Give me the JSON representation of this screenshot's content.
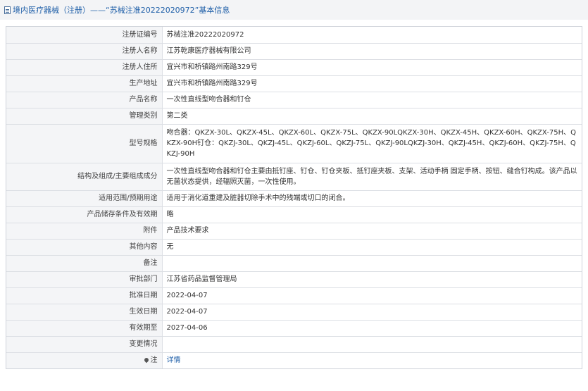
{
  "header": {
    "title": "境内医疗器械（注册）——“苏械注准20222020972”基本信息"
  },
  "rows": [
    {
      "label": "注册证编号",
      "value": "苏械注准20222020972"
    },
    {
      "label": "注册人名称",
      "value": "江苏乾康医疗器械有限公司"
    },
    {
      "label": "注册人住所",
      "value": "宜兴市和桥镇路州南路329号"
    },
    {
      "label": "生产地址",
      "value": "宜兴市和桥镇路州南路329号"
    },
    {
      "label": "产品名称",
      "value": "一次性直线型吻合器和钉仓"
    },
    {
      "label": "管理类别",
      "value": "第二类"
    },
    {
      "label": "型号规格",
      "value": "吻合器：QKZX-30L、QKZX-45L、QKZX-60L、QKZX-75L、QKZX-90LQKZX-30H、QKZX-45H、QKZX-60H、QKZX-75H、QKZX-90H钉仓：QKZJ-30L、QKZJ-45L、QKZJ-60L、QKZJ-75L、QKZJ-90LQKZJ-30H、QKZJ-45H、QKZJ-60H、QKZJ-75H、QKZJ-90H"
    },
    {
      "label": "结构及组成/主要组成成分",
      "value": "一次性直线型吻合器和钉仓主要由抵钉座、钉仓、钉仓夹板、抵钉座夹板、支架、活动手柄 固定手柄、按钮、缝合钉构成。该产品以无菌状态提供，经辐照灭菌，一次性使用。"
    },
    {
      "label": "适用范围/预期用途",
      "value": "适用于消化道重建及脏器切除手术中的残端或切口的闭合。"
    },
    {
      "label": "产品储存条件及有效期",
      "value": "略"
    },
    {
      "label": "附件",
      "value": "产品技术要求"
    },
    {
      "label": "其他内容",
      "value": "无"
    },
    {
      "label": "备注",
      "value": ""
    },
    {
      "label": "审批部门",
      "value": "江苏省药品监督管理局"
    },
    {
      "label": "批准日期",
      "value": "2022-04-07"
    },
    {
      "label": "生效日期",
      "value": "2022-04-07"
    },
    {
      "label": "有效期至",
      "value": "2027-04-06"
    },
    {
      "label": "变更情况",
      "value": ""
    }
  ],
  "footer_row": {
    "label": "注",
    "link_text": "详情"
  },
  "colors": {
    "title": "#1f5fa8",
    "label_bg": "#f4f5f7",
    "border": "#dcdfe4"
  }
}
